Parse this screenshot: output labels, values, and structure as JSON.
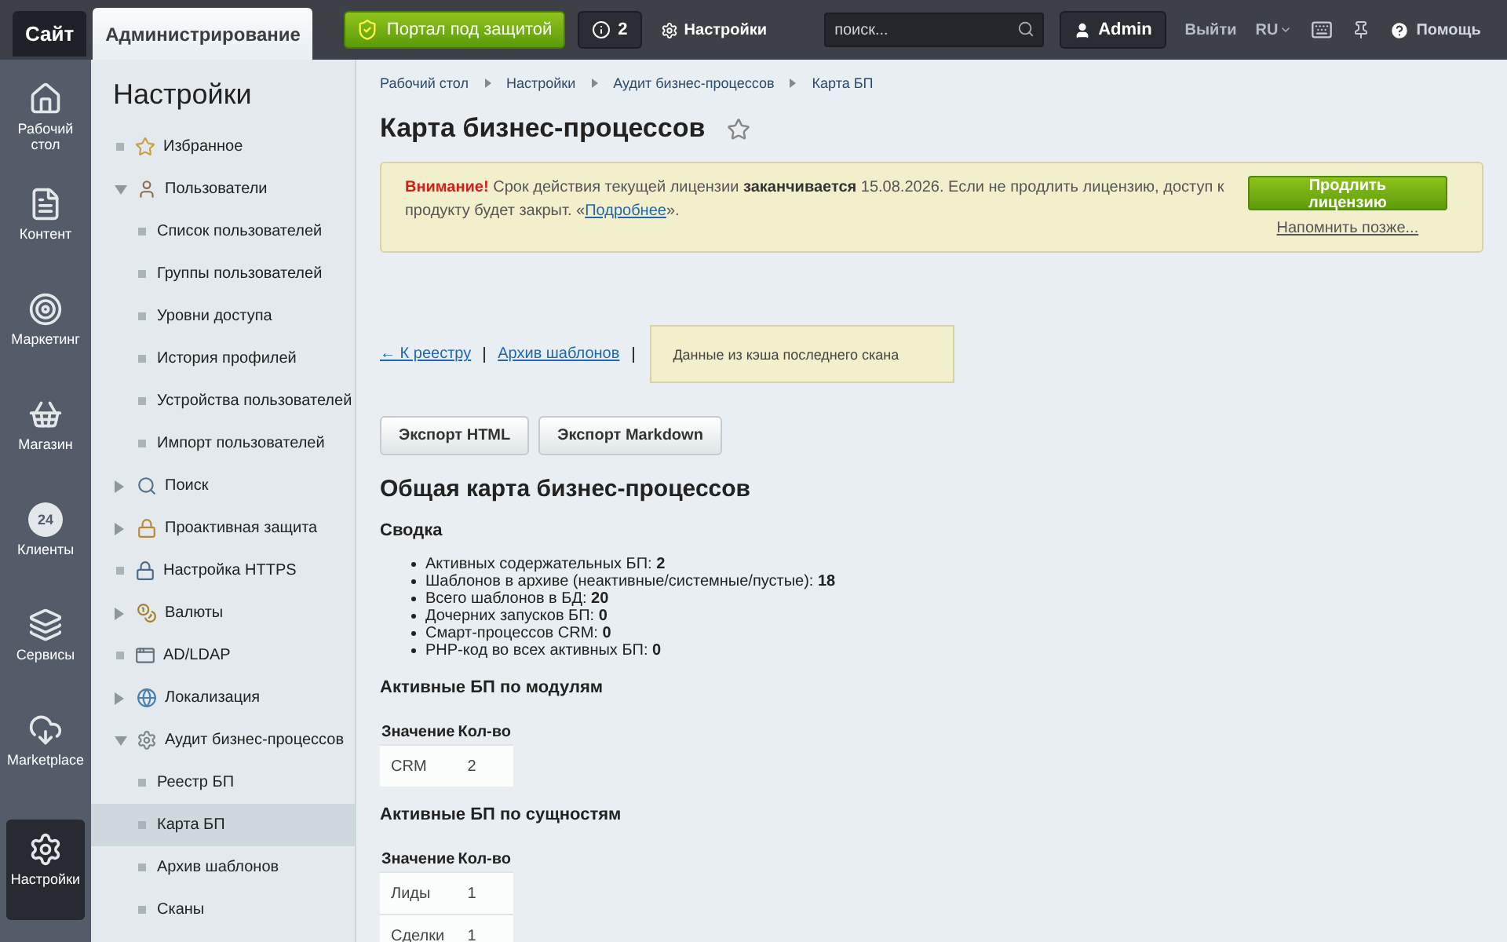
{
  "topbar": {
    "tabs": [
      {
        "label": "Сайт",
        "selected": false
      },
      {
        "label": "Администрирование",
        "selected": true
      }
    ],
    "security_button": "Портал под защитой",
    "notifications": "2",
    "settings": "Настройки",
    "search": {
      "placeholder": "поиск..."
    },
    "user": "Admin",
    "logout": "Выйти",
    "language": "RU",
    "help": "Помощь"
  },
  "rail": [
    {
      "label": "Рабочий стол",
      "selected": false
    },
    {
      "label": "Контент",
      "selected": false
    },
    {
      "label": "Маркетинг",
      "selected": false
    },
    {
      "label": "Магазин",
      "selected": false
    },
    {
      "label": "Клиенты",
      "badge": "24",
      "selected": false
    },
    {
      "label": "Сервисы",
      "selected": false
    },
    {
      "label": "Marketplace",
      "selected": false
    },
    {
      "label": "Настройки",
      "selected": true
    }
  ],
  "sidebar": {
    "title": "Настройки",
    "items": [
      {
        "label": "Избранное",
        "kind": "link",
        "selected": false
      },
      {
        "label": "Пользователи",
        "kind": "group",
        "expanded": true,
        "selected": false,
        "children": [
          {
            "label": "Список пользователей",
            "selected": false
          },
          {
            "label": "Группы пользователей",
            "selected": false
          },
          {
            "label": "Уровни доступа",
            "selected": false
          },
          {
            "label": "История профилей",
            "selected": false
          },
          {
            "label": "Устройства пользователей",
            "selected": false
          },
          {
            "label": "Импорт пользователей",
            "selected": false
          }
        ]
      },
      {
        "label": "Поиск",
        "kind": "group",
        "expanded": false,
        "selected": false
      },
      {
        "label": "Проактивная защита",
        "kind": "group",
        "expanded": false,
        "selected": false
      },
      {
        "label": "Настройка HTTPS",
        "kind": "link",
        "selected": false
      },
      {
        "label": "Валюты",
        "kind": "group",
        "expanded": false,
        "selected": false
      },
      {
        "label": "AD/LDAP",
        "kind": "link",
        "selected": false
      },
      {
        "label": "Локализация",
        "kind": "group",
        "expanded": false,
        "selected": false
      },
      {
        "label": "Аудит бизнес-процессов",
        "kind": "group",
        "expanded": true,
        "selected": false,
        "children": [
          {
            "label": "Реестр БП",
            "selected": false
          },
          {
            "label": "Карта БП",
            "selected": true
          },
          {
            "label": "Архив шаблонов",
            "selected": false
          },
          {
            "label": "Сканы",
            "selected": false
          }
        ]
      }
    ]
  },
  "breadcrumbs": [
    "Рабочий стол",
    "Настройки",
    "Аудит бизнес-процессов",
    "Карта БП"
  ],
  "page_title": "Карта бизнес-процессов",
  "notice": {
    "text_before": "**Внимание!** Срок действия текущей лицензии **заканчивается** 15.08.2026. Если не продлить лицензию, доступ к продукту будет закрыт. «",
    "link": "Подробнее",
    "text_after": "».",
    "button": "Продлить лицензию",
    "remind": "Напомнить позже..."
  },
  "nav_links": [
    "← К реестру",
    "Архив шаблонов"
  ],
  "cache_note": "Данные из кэша последнего скана",
  "export_buttons": [
    "Экспорт HTML",
    "Экспорт Markdown"
  ],
  "heading": "Общая карта бизнес-процессов",
  "summary": {
    "title": "Сводка",
    "items": [
      "Активных содержательных БП: **2**",
      "Шаблонов в архиве (неактивные/системные/пустые): **18**",
      "Всего шаблонов в БД: **20**",
      "Дочерних запусков БП: **0**",
      "Смарт-процессов CRM: **0**",
      "PHP-код во всех активных БП: **0**"
    ]
  },
  "tables": [
    {
      "title": "Активные БП по модулям",
      "columns": [
        "Значение",
        "Кол-во"
      ],
      "rows": [
        [
          "CRM",
          "2"
        ]
      ]
    },
    {
      "title": "Активные БП по сущностям",
      "columns": [
        "Значение",
        "Кол-во"
      ],
      "rows": [
        [
          "Лиды",
          "1"
        ],
        [
          "Сделки",
          "1"
        ]
      ]
    }
  ]
}
